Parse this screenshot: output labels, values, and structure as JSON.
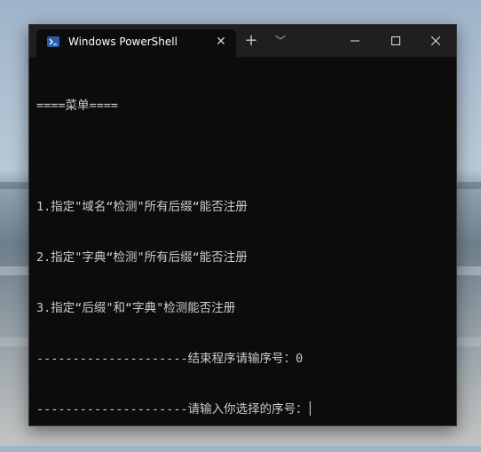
{
  "window": {
    "tab_title": "Windows PowerShell",
    "tab_icon": "powershell-icon",
    "new_tab_glyph": "+",
    "dropdown_glyph": "﹀",
    "close_tab_glyph": "✕"
  },
  "console": {
    "lines": [
      "====菜单====",
      "",
      "1.指定\"域名“检测\"所有后缀“能否注册",
      "2.指定\"字典“检测\"所有后缀“能否注册",
      "3.指定“后缀\"和“字典\"检测能否注册",
      "---------------------结束程序请输序号：0",
      "---------------------请输入你选择的序号："
    ]
  },
  "colors": {
    "terminal_bg": "#0c0c0c",
    "titlebar_bg": "#1f1f1f",
    "text": "#cccccc",
    "icon_blue": "#2a5ea8"
  }
}
